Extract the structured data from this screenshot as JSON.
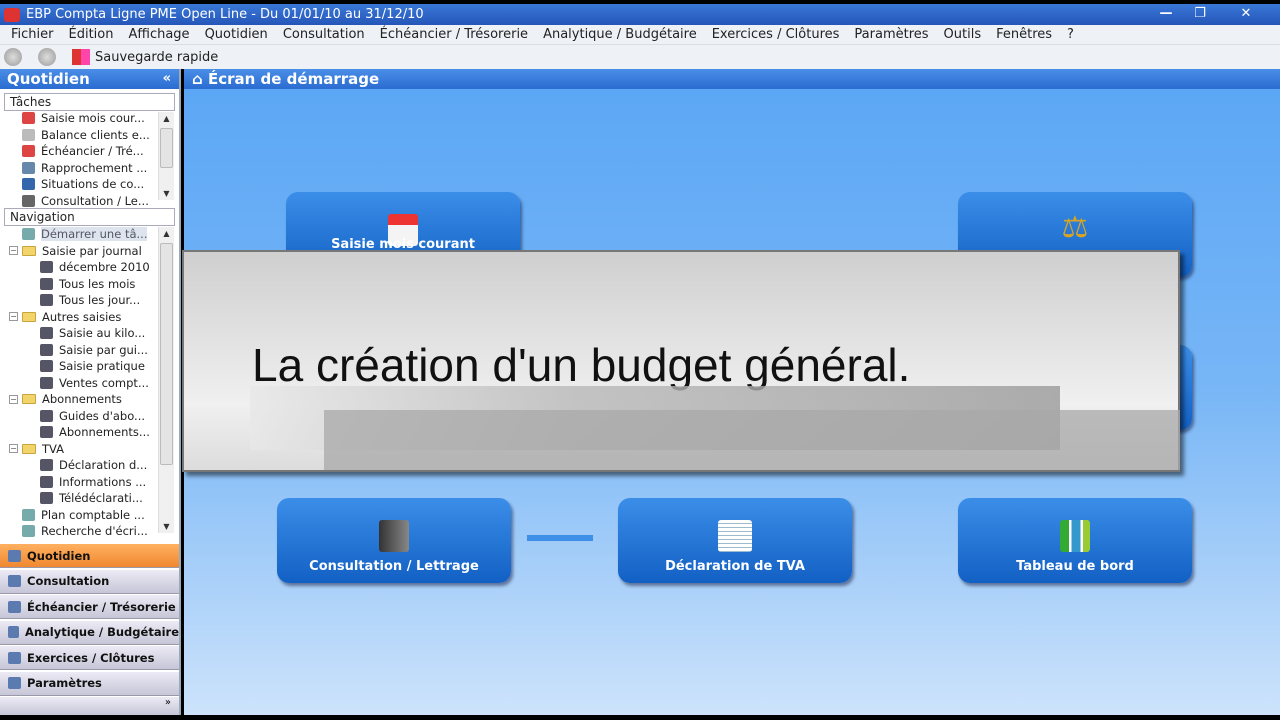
{
  "window": {
    "title": "EBP Compta Ligne PME Open Line - Du 01/01/10 au 31/12/10"
  },
  "menu": [
    "Fichier",
    "Édition",
    "Affichage",
    "Quotidien",
    "Consultation",
    "Échéancier / Trésorerie",
    "Analytique / Budgétaire",
    "Exercices / Clôtures",
    "Paramètres",
    "Outils",
    "Fenêtres",
    "?"
  ],
  "toolbar": {
    "quick_save": "Sauvegarde rapide"
  },
  "sidebar": {
    "title": "Quotidien",
    "collapse": "«",
    "tasks_header": "Tâches",
    "tasks": [
      "Saisie mois cour...",
      "Balance clients e...",
      "Échéancier / Tré...",
      "Rapprochement ...",
      "Situations de co...",
      "Consultation / Le..."
    ],
    "nav_header": "Navigation",
    "nav": [
      {
        "label": "Démarrer une tâ...",
        "level": 0
      },
      {
        "label": "Saisie par journal",
        "level": 0,
        "folder": true
      },
      {
        "label": "décembre 2010",
        "level": 1
      },
      {
        "label": "Tous les mois",
        "level": 1
      },
      {
        "label": "Tous les jour...",
        "level": 1
      },
      {
        "label": "Autres saisies",
        "level": 0,
        "folder": true
      },
      {
        "label": "Saisie au kilo...",
        "level": 1
      },
      {
        "label": "Saisie par gui...",
        "level": 1
      },
      {
        "label": "Saisie pratique",
        "level": 1
      },
      {
        "label": "Ventes compt...",
        "level": 1
      },
      {
        "label": "Abonnements",
        "level": 0,
        "folder": true
      },
      {
        "label": "Guides d'abo...",
        "level": 1
      },
      {
        "label": "Abonnements...",
        "level": 1
      },
      {
        "label": "TVA",
        "level": 0,
        "folder": true
      },
      {
        "label": "Déclaration d...",
        "level": 1
      },
      {
        "label": "Informations ...",
        "level": 1
      },
      {
        "label": "Télédéclarati...",
        "level": 1
      },
      {
        "label": "Plan comptable ...",
        "level": 0
      },
      {
        "label": "Recherche d'écri...",
        "level": 0
      }
    ],
    "sections": [
      "Quotidien",
      "Consultation",
      "Échéancier / Trésorerie",
      "Analytique / Budgétaire",
      "Exercices / Clôtures",
      "Paramètres"
    ],
    "active_section": "Quotidien"
  },
  "main": {
    "title": "Écran de démarrage",
    "tiles": {
      "saisie": "Saisie mois courant",
      "consultation": "Consultation / Lettrage",
      "tva": "Déclaration de TVA",
      "tableau": "Tableau de bord"
    },
    "overlay_caption": "La création d'un budget général."
  }
}
